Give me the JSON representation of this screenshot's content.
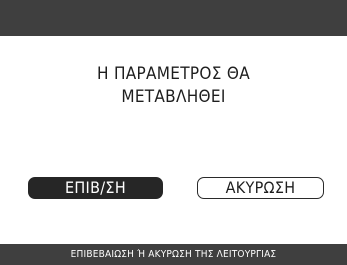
{
  "dialog": {
    "message": "Η ΠΑΡΑΜΕΤΡΟΣ ΘΑ\nΜΕΤΑΒΛΗΘΕΙ"
  },
  "buttons": {
    "confirm_label": "ΕΠΙΒ/ΣΗ",
    "cancel_label": "ΑΚΥΡΩΣΗ"
  },
  "footer": {
    "hint": "ΕΠΙΒΕΒΑΙΩΣΗ Ή ΑΚΥΡΩΣΗ ΤΗΣ ΛΕΙΤΟΥΡΓΙΑΣ"
  },
  "colors": {
    "bar_background": "#3f3f3f",
    "dialog_background": "#ffffff",
    "confirm_button": "#262626",
    "text_dark": "#1e1e1e"
  }
}
